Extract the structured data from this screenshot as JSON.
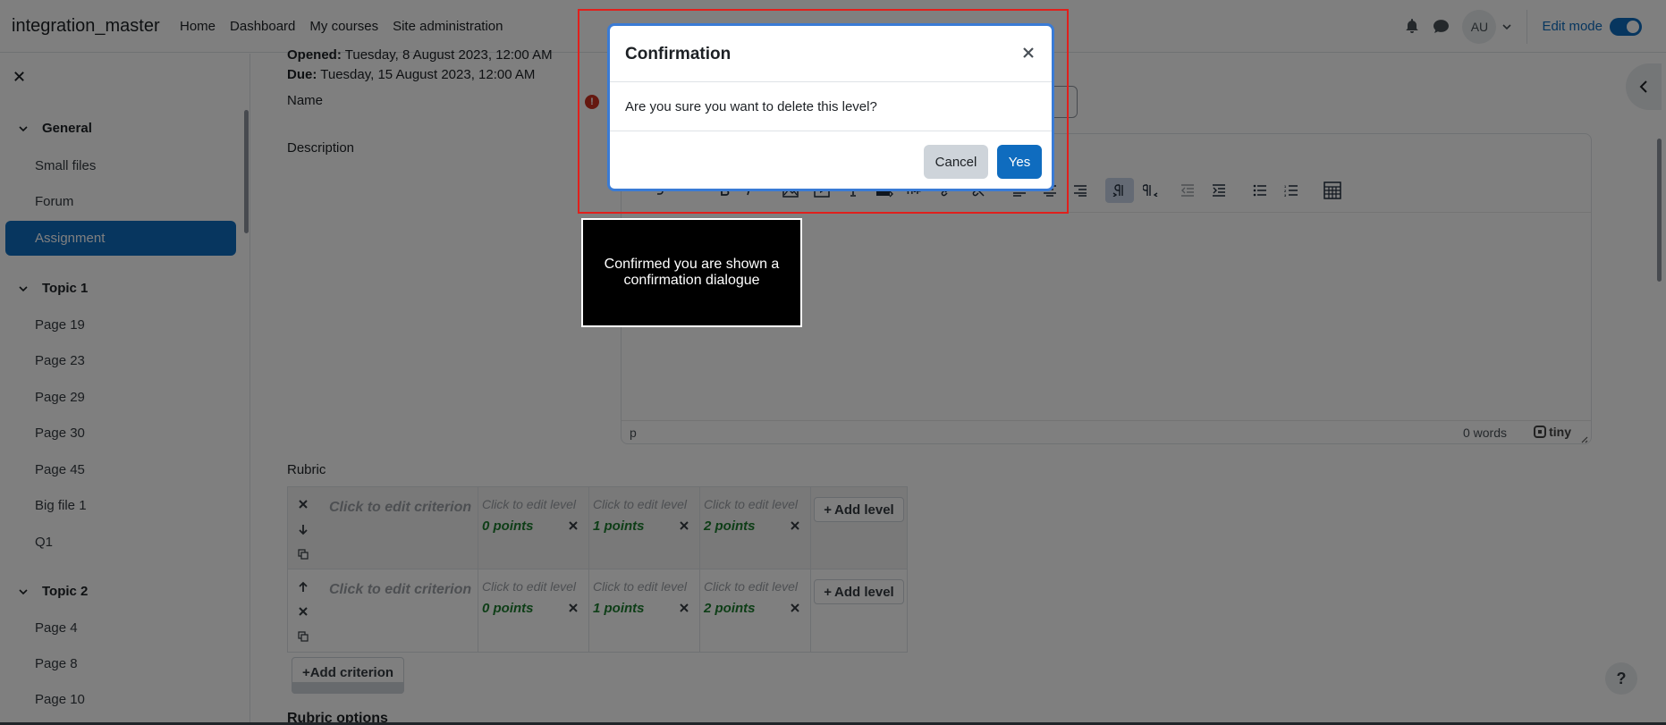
{
  "navbar": {
    "brand": "integration_master",
    "links": [
      "Home",
      "Dashboard",
      "My courses",
      "Site administration"
    ],
    "avatar_initials": "AU",
    "edit_mode_label": "Edit mode"
  },
  "sidebar": {
    "sections": [
      {
        "title": "General",
        "items": [
          "Small files",
          "Forum",
          "Assignment"
        ]
      },
      {
        "title": "Topic 1",
        "items": [
          "Page 19",
          "Page 23",
          "Page 29",
          "Page 30",
          "Page 45",
          "Big file 1",
          "Q1"
        ]
      },
      {
        "title": "Topic 2",
        "items": [
          "Page 4",
          "Page 8",
          "Page 10"
        ]
      }
    ],
    "active_item": "Assignment"
  },
  "main": {
    "opened_label": "Opened:",
    "opened_value": "Tuesday, 8 August 2023, 12:00 AM",
    "due_label": "Due:",
    "due_value": "Tuesday, 15 August 2023, 12:00 AM",
    "name_label": "Name",
    "name_error_icon": "!",
    "description_label": "Description",
    "editor": {
      "statusbar_path": "p",
      "word_count": "0 words",
      "brand": "tiny"
    },
    "rubric_label": "Rubric",
    "rubric": {
      "criteria": [
        {
          "description_placeholder": "Click to edit criterion",
          "levels": [
            {
              "definition": "Click to edit level",
              "points": "0 points"
            },
            {
              "definition": "Click to edit level",
              "points": "1 points"
            },
            {
              "definition": "Click to edit level",
              "points": "2 points"
            }
          ]
        },
        {
          "description_placeholder": "Click to edit criterion",
          "levels": [
            {
              "definition": "Click to edit level",
              "points": "0 points"
            },
            {
              "definition": "Click to edit level",
              "points": "1 points"
            },
            {
              "definition": "Click to edit level",
              "points": "2 points"
            }
          ]
        }
      ],
      "add_level_label": "Add level",
      "add_criterion_label": "Add criterion"
    },
    "rubric_options_label": "Rubric options",
    "help_label": "?"
  },
  "modal": {
    "title": "Confirmation",
    "body": "Are you sure you want to delete this level?",
    "cancel_label": "Cancel",
    "yes_label": "Yes"
  },
  "annotation": {
    "caption": "Confirmed you are shown a confirmation dialogue"
  },
  "colors": {
    "primary": "#0f6cbf",
    "points_green": "#1c7c2e",
    "highlight_red": "#e0201c"
  }
}
